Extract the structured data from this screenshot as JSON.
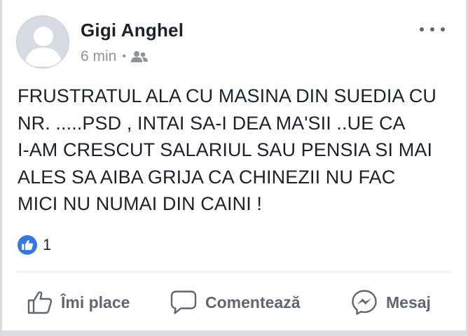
{
  "post": {
    "author_name": "Gigi Anghel",
    "timestamp": "6 min",
    "separator": "•",
    "audience_icon": "friends-icon",
    "body_lines": [
      "FRUSTRATUL ALA CU MASINA DIN SUEDIA CU",
      "NR. .....PSD , INTAI SA-I DEA MA'SII ..UE CA",
      "I-AM CRESCUT SALARIUL SAU PENSIA SI MAI",
      "ALES SA AIBA GRIJA CA CHINEZII NU FAC",
      "MICI NU NUMAI DIN CAINI !"
    ],
    "reaction_icon": "like-reaction-icon",
    "reaction_count": "1"
  },
  "actions": {
    "like_label": "Îmi place",
    "comment_label": "Comentează",
    "message_label": "Mesaj"
  },
  "colors": {
    "author_text": "#1d2129",
    "meta_text": "#8d949e",
    "action_text": "#606770",
    "like_blue": "#3578e5",
    "avatar_bg": "#d7dbe3"
  }
}
